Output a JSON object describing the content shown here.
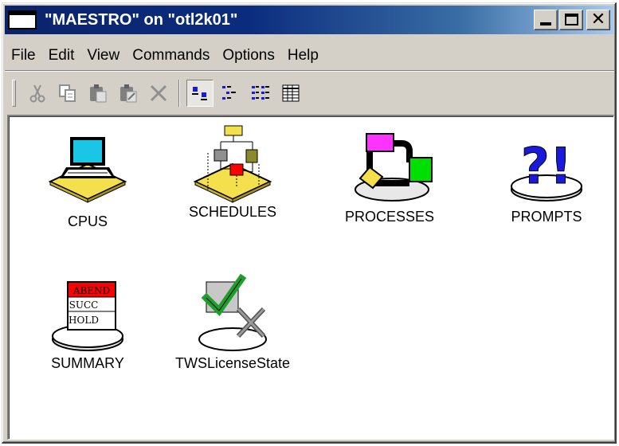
{
  "window": {
    "title": "\"MAESTRO\" on \"otl2k01\""
  },
  "title_buttons": {
    "minimize_icon": "minimize-icon",
    "maximize_icon": "maximize-icon",
    "close_icon": "close-icon",
    "close_glyph": "✕"
  },
  "menu": {
    "items": [
      "File",
      "Edit",
      "View",
      "Commands",
      "Options",
      "Help"
    ]
  },
  "toolbar": {
    "tools": [
      {
        "name": "cut-icon",
        "glyph": "✂",
        "enabled": false
      },
      {
        "name": "copy-icon",
        "glyph": "⧉",
        "enabled": false
      },
      {
        "name": "paste-icon",
        "glyph": "▣",
        "enabled": false
      },
      {
        "name": "paste-special-icon",
        "glyph": "▤",
        "enabled": false
      },
      {
        "name": "delete-icon",
        "glyph": "✕",
        "enabled": false
      },
      {
        "name": "large-icons-view-icon",
        "glyph": "▫▪",
        "enabled": true,
        "active": true
      },
      {
        "name": "small-icons-view-icon",
        "glyph": "⋮▪",
        "enabled": true
      },
      {
        "name": "list-view-icon",
        "glyph": "☷",
        "enabled": true
      },
      {
        "name": "details-view-icon",
        "glyph": "▦",
        "enabled": true
      }
    ]
  },
  "items": [
    {
      "label": "CPUS",
      "icon": "cpus-icon"
    },
    {
      "label": "SCHEDULES",
      "icon": "schedules-icon"
    },
    {
      "label": "PROCESSES",
      "icon": "processes-icon"
    },
    {
      "label": "PROMPTS",
      "icon": "prompts-icon"
    },
    {
      "label": "SUMMARY",
      "icon": "summary-icon",
      "badges": [
        "ABEND",
        "SUCC",
        "HOLD"
      ]
    },
    {
      "label": "TWSLicenseState",
      "icon": "license-state-icon"
    }
  ],
  "prompts_glyph": "?!",
  "colors": {
    "titlebar": "#0a246a",
    "face": "#d4d0c8",
    "disk_yellow": "#f4e04d",
    "abend_red": "#ff0000",
    "check_green": "#1e9e2a",
    "prompt_blue": "#1a1adc"
  }
}
